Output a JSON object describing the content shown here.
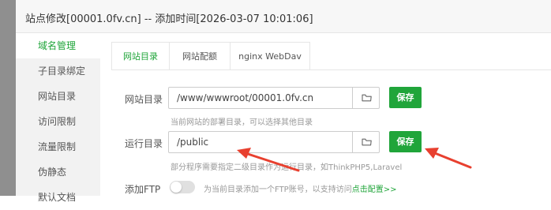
{
  "dialog": {
    "title": "站点修改[00001.0fv.cn] -- 添加时间[2026-03-07 10:01:06]"
  },
  "sidebar": {
    "items": [
      {
        "label": "域名管理",
        "active": true
      },
      {
        "label": "子目录绑定",
        "active": false
      },
      {
        "label": "网站目录",
        "active": false
      },
      {
        "label": "访问限制",
        "active": false
      },
      {
        "label": "流量限制",
        "active": false
      },
      {
        "label": "伪静态",
        "active": false
      },
      {
        "label": "默认文档",
        "active": false
      }
    ]
  },
  "tabs": [
    {
      "label": "网站目录",
      "active": true
    },
    {
      "label": "网站配额",
      "active": false
    },
    {
      "label": "nginx WebDav",
      "active": false
    }
  ],
  "site_dir": {
    "label": "网站目录",
    "value": "/www/wwwroot/00001.0fv.cn",
    "save_label": "保存",
    "hint": "当前网站的部署目录，可以选择其他目录"
  },
  "run_dir": {
    "label": "运行目录",
    "value": "/public",
    "save_label": "保存",
    "hint": "部分程序需要指定二级目录作为运行目录，如ThinkPHP5,Laravel"
  },
  "ftp": {
    "label": "添加FTP",
    "enabled": false,
    "hint": "为当前目录添加一个FTP账号，以支持访问",
    "link": "点击配置>>"
  },
  "colors": {
    "accent": "#20a53a",
    "arrow": "#e8402f"
  },
  "icons": {
    "folder": "folder-icon"
  }
}
